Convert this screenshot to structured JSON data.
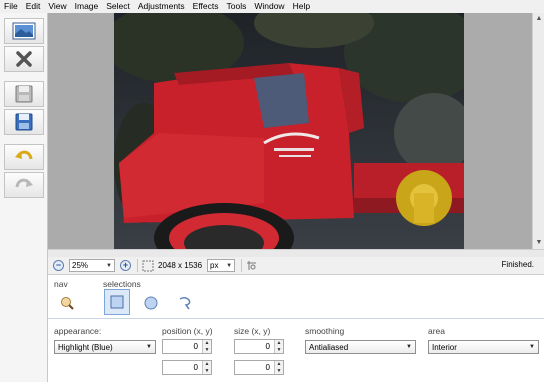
{
  "menu": [
    "File",
    "Edit",
    "View",
    "Image",
    "Select",
    "Adjustments",
    "Effects",
    "Tools",
    "Window",
    "Help"
  ],
  "toolbar": [
    {
      "name": "open-image-icon"
    },
    {
      "name": "close-x-icon"
    },
    {
      "name": "save-disk-icon"
    },
    {
      "name": "save-as-disk-icon"
    },
    {
      "name": "undo-arrow-icon"
    },
    {
      "name": "redo-arrow-icon"
    }
  ],
  "statusbar": {
    "zoom_out": "−",
    "zoom_value": "25%",
    "zoom_in": "+",
    "image_size": "2048 x 1536",
    "unit": "px",
    "status": "Finished."
  },
  "tools": {
    "nav_label": "nav",
    "selections_label": "selections"
  },
  "options": {
    "appearance": {
      "label": "appearance:",
      "value": "Highlight (Blue)"
    },
    "position": {
      "label": "position (x, y)",
      "x": "0",
      "y": "0"
    },
    "size": {
      "label": "size (x, y)",
      "x": "0",
      "y": "0"
    },
    "smoothing": {
      "label": "smoothing",
      "value": "Antialiased"
    },
    "area": {
      "label": "area",
      "value": "Interior"
    }
  }
}
